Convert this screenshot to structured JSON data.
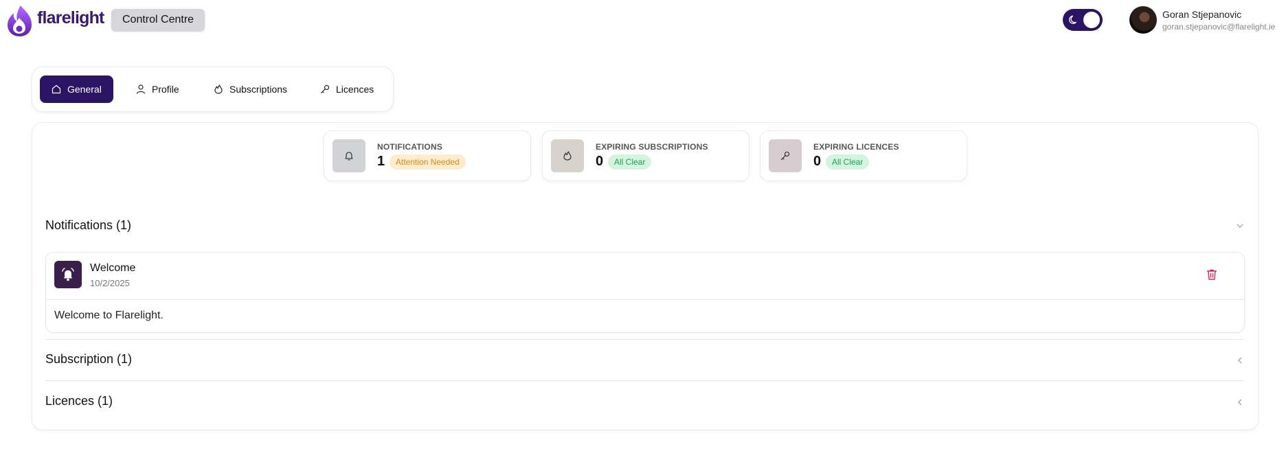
{
  "header": {
    "brand": "flarelight",
    "control_centre_label": "Control Centre",
    "theme_toggle": {
      "mode": "dark",
      "icon": "moon-icon"
    },
    "user": {
      "name": "Goran Stjepanovic",
      "email": "goran.stjepanovic@flarelight.ie"
    }
  },
  "tabs": [
    {
      "label": "General",
      "icon": "home-icon",
      "active": true
    },
    {
      "label": "Profile",
      "icon": "user-icon",
      "active": false
    },
    {
      "label": "Subscriptions",
      "icon": "flame-icon",
      "active": false
    },
    {
      "label": "Licences",
      "icon": "key-icon",
      "active": false
    }
  ],
  "stats": [
    {
      "label": "NOTIFICATIONS",
      "count": "1",
      "badge": "Attention Needed",
      "status": "warning",
      "icon": "bell-icon",
      "icon_bg": "#d0d2d6"
    },
    {
      "label": "EXPIRING SUBSCRIPTIONS",
      "count": "0",
      "badge": "All Clear",
      "status": "ok",
      "icon": "flame-icon",
      "icon_bg": "#d7d2cc"
    },
    {
      "label": "EXPIRING LICENCES",
      "count": "0",
      "badge": "All Clear",
      "status": "ok",
      "icon": "key-icon",
      "icon_bg": "#d7cccf"
    }
  ],
  "sections": {
    "notifications": {
      "title": "Notifications (1)",
      "expanded": true,
      "items": [
        {
          "title": "Welcome",
          "date": "10/2/2025",
          "body": "Welcome to Flarelight."
        }
      ]
    },
    "subscription": {
      "title": "Subscription (1)",
      "expanded": false
    },
    "licences": {
      "title": "Licences (1)",
      "expanded": false
    }
  },
  "colors": {
    "brand": "#2b1463",
    "warning_badge_bg": "#fdeccd",
    "warning_badge_text": "#d38b1a",
    "ok_badge_bg": "#d3f5df",
    "ok_badge_text": "#1f9e4d",
    "delete": "#d6225c"
  }
}
